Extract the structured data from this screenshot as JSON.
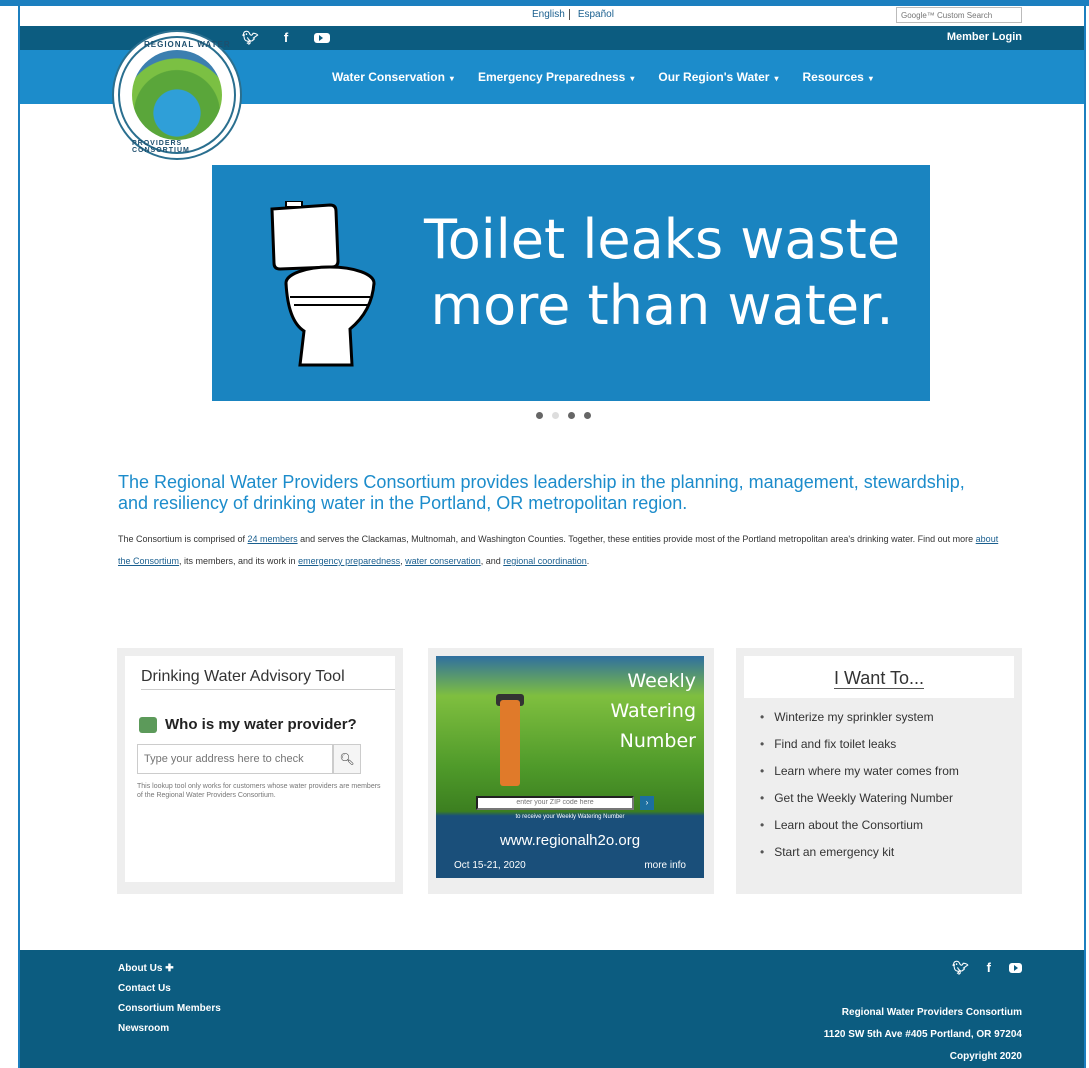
{
  "lang": {
    "english": "English",
    "spanish": "Español"
  },
  "search": {
    "placeholder": "Google™ Custom Search"
  },
  "header": {
    "member_login": "Member Login"
  },
  "nav": [
    {
      "label": "Water Conservation"
    },
    {
      "label": "Emergency Preparedness"
    },
    {
      "label": "Our Region's Water"
    },
    {
      "label": "Resources"
    }
  ],
  "logo": {
    "top_text": "REGIONAL WATER",
    "bottom_text": "PROVIDERS CONSORTIUM"
  },
  "banner": {
    "line1": "Toilet leaks waste",
    "line2": "more than water."
  },
  "intro": {
    "heading": "The Regional Water Providers Consortium provides leadership in the planning, management, stewardship, and resiliency of drinking water in the Portland, OR metropolitan region.",
    "p1": "The Consortium is comprised of ",
    "link_members": "24 members",
    "p2": " and serves the Clackamas, Multnomah, and Washington Counties. Together, these entities provide most of the Portland metropolitan area's drinking water. Find out more ",
    "link_about": "about the Consortium",
    "p3": ", its members, and its work in ",
    "link_emergency": "emergency preparedness",
    "p4": ", ",
    "link_conservation": "water conservation",
    "p5": ", and ",
    "link_regional": "regional coordination",
    "p6": "."
  },
  "advisory": {
    "title": "Drinking Water Advisory Tool",
    "question": "Who is my water provider?",
    "input_placeholder": "Type your address here to check",
    "disclaimer": "This lookup tool only works for customers whose water providers are members of the Regional Water Providers Consortium."
  },
  "weekly": {
    "title_l1": "Weekly",
    "title_l2": "Watering",
    "title_l3": "Number",
    "zip_placeholder": "enter your ZIP code here",
    "zip_note": "to receive your Weekly Watering Number",
    "site": "www.regionalh2o.org",
    "date": "Oct 15-21, 2020",
    "more": "more info"
  },
  "want": {
    "title": "I Want To...",
    "items": [
      "Winterize my sprinkler system",
      "Find and fix toilet leaks",
      "Learn where my water comes from",
      "Get the Weekly Watering Number",
      "Learn about the Consortium",
      "Start an emergency kit"
    ]
  },
  "footer": {
    "links": [
      "About Us",
      "Contact Us",
      "Consortium Members",
      "Newsroom"
    ],
    "org": "Regional Water Providers Consortium",
    "address": "1120 SW 5th Ave #405 Portland, OR 97204",
    "copyright": "Copyright 2020"
  },
  "colors": {
    "primary": "#1c8ccb",
    "dark": "#0c5c80",
    "card_bg": "#eeeeee"
  }
}
